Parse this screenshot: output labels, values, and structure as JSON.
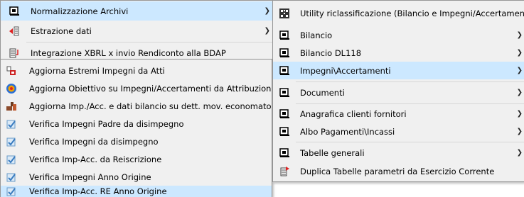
{
  "menu1": {
    "items": [
      {
        "label": "Normalizzazione Archivi",
        "icon": "module-icon",
        "has_submenu": true,
        "highlighted": true
      },
      {
        "label": "Estrazione dati",
        "icon": "export-icon",
        "has_submenu": true
      },
      {
        "label": "Integrazione XBRL x invio Rendiconto alla BDAP",
        "icon": "document-arrow-icon",
        "has_submenu": false
      }
    ]
  },
  "menu2": {
    "items": [
      {
        "label": "Aggiorna Estremi Impegni da Atti",
        "icon": "acts-icon"
      },
      {
        "label": "Aggiorna Obiettivo su Impegni/Accertamenti da Attribuzioni",
        "icon": "target-icon"
      },
      {
        "label": "Aggiorna Imp./Acc. e dati bilancio su dett. mov. economato",
        "icon": "hammer-icon"
      },
      {
        "label": "Verifica Impegni  Padre da disimpegno",
        "icon": "check-doc-icon"
      },
      {
        "label": "Verifica Impegni da disimpegno",
        "icon": "check-doc-icon"
      },
      {
        "label": "Verifica Imp-Acc. da Reiscrizione",
        "icon": "check-doc-icon"
      },
      {
        "label": "Verifica Impegni Anno Origine",
        "icon": "check-doc-icon"
      },
      {
        "label": "Verifica Imp-Acc. RE Anno Origine",
        "icon": "check-doc-icon",
        "highlighted": true
      }
    ]
  },
  "menu3": {
    "items": [
      {
        "label": "Utility riclassificazione (Bilancio e Impegni/Accertamenti)",
        "icon": "grid-icon",
        "has_submenu": false
      },
      {
        "label": "Bilancio",
        "icon": "module-icon",
        "has_submenu": true
      },
      {
        "label": "Bilancio DL118",
        "icon": "module-icon",
        "has_submenu": true
      },
      {
        "label": "Impegni\\Accertamenti",
        "icon": "module-icon",
        "has_submenu": true,
        "highlighted": true
      },
      {
        "label": "Documenti",
        "icon": "module-icon",
        "has_submenu": true
      },
      {
        "label": "Anagrafica clienti fornitori",
        "icon": "module-icon",
        "has_submenu": true
      },
      {
        "label": "Albo Pagamenti\\Incassi",
        "icon": "module-icon",
        "has_submenu": true
      },
      {
        "label": "Tabelle generali",
        "icon": "module-icon",
        "has_submenu": true
      },
      {
        "label": "Duplica Tabelle parametri da Esercizio Corrente",
        "icon": "duplicate-icon",
        "has_submenu": false
      }
    ]
  },
  "colors": {
    "menu_bg": "#f0f0f0",
    "highlight": "#cce8ff",
    "border": "#979797"
  }
}
